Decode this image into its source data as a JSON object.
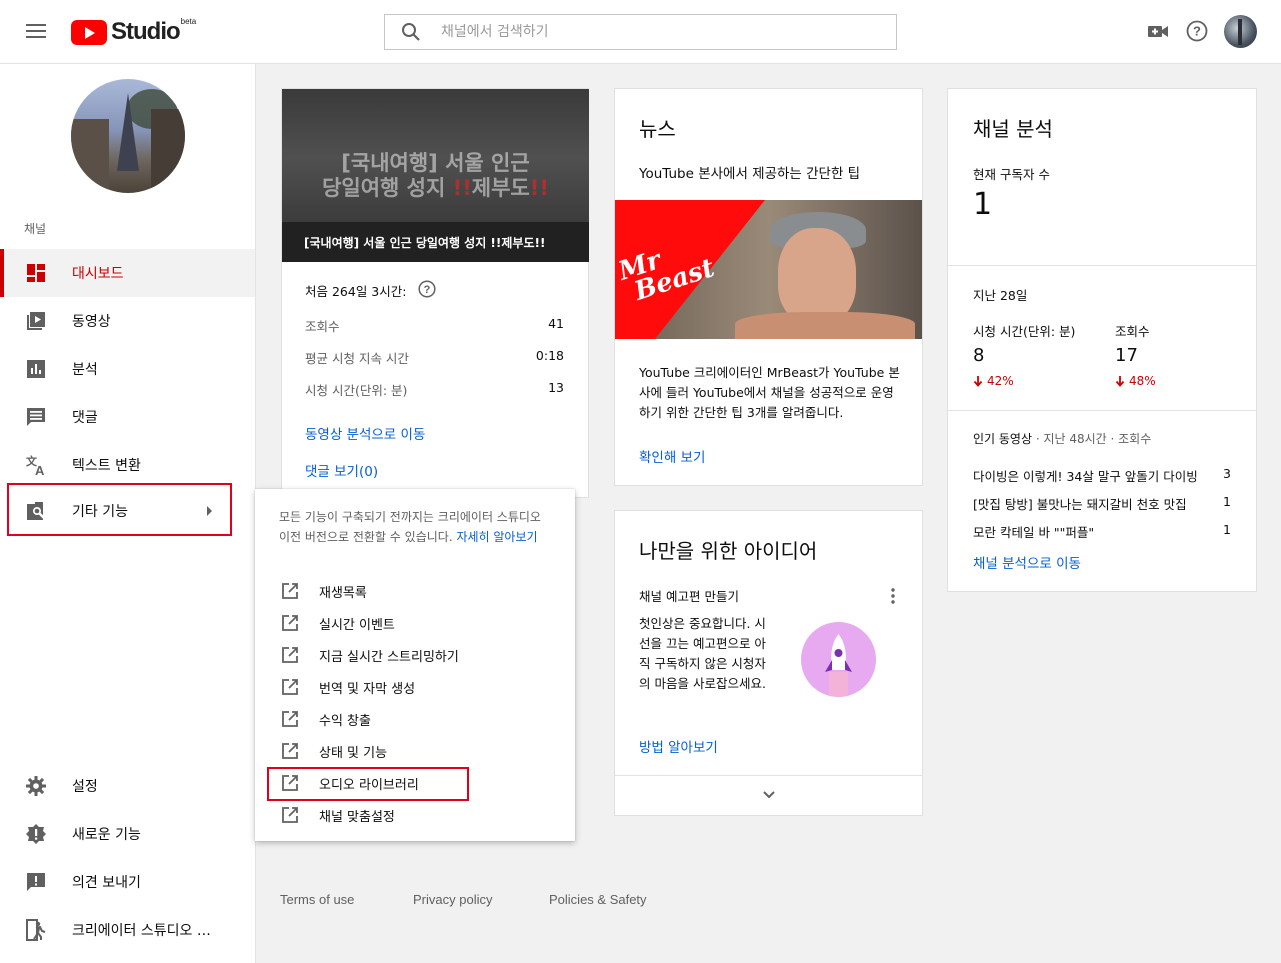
{
  "header": {
    "logo_text": "Studio",
    "logo_badge": "beta",
    "search_placeholder": "채널에서 검색하기"
  },
  "sidebar": {
    "section_label": "채널",
    "items": [
      {
        "label": "대시보드",
        "icon": "dashboard-icon"
      },
      {
        "label": "동영상",
        "icon": "video-library-icon"
      },
      {
        "label": "분석",
        "icon": "analytics-icon"
      },
      {
        "label": "댓글",
        "icon": "comments-icon"
      },
      {
        "label": "텍스트 변환",
        "icon": "translate-icon"
      },
      {
        "label": "기타 기능",
        "icon": "other-features-icon"
      }
    ],
    "bottom_items": [
      {
        "label": "설정",
        "icon": "gear-icon"
      },
      {
        "label": "새로운 기능",
        "icon": "whats-new-icon"
      },
      {
        "label": "의견 보내기",
        "icon": "feedback-icon"
      },
      {
        "label": "크리에이터 스튜디오 …",
        "icon": "classic-studio-icon"
      }
    ]
  },
  "latest_video": {
    "thumb_line1": "[국내여행] 서울 인근",
    "thumb_line2a": "당일여행 성지 ",
    "thumb_line2_mark1": "!!",
    "thumb_line2b": "제부도",
    "thumb_line2_mark2": "!!",
    "title": "[국내여행] 서울 인근 당일여행 성지 !!제부도!!",
    "first_period": "처음 264일 3시간:",
    "stats": [
      {
        "label": "조회수",
        "value": "41"
      },
      {
        "label": "평균 시청 지속 시간",
        "value": "0:18"
      },
      {
        "label": "시청 시간(단위: 분)",
        "value": "13"
      }
    ],
    "analytics_link": "동영상 분석으로 이동",
    "comments_link": "댓글 보기(0)"
  },
  "news": {
    "title": "뉴스",
    "subtitle": "YouTube 본사에서 제공하는 간단한 팁",
    "thumb_text_1": "Mr",
    "thumb_text_2": "Beast",
    "body": "YouTube 크리에이터인 MrBeast가 YouTube 본사에 들러 YouTube에서 채널을 성공적으로 운영하기 위한 간단한 팁 3개를 알려줍니다.",
    "link": "확인해 보기"
  },
  "ideas": {
    "title": "나만을 위한 아이디어",
    "item_title": "채널 예고편 만들기",
    "body": "첫인상은 중요합니다. 시선을 끄는 예고편으로 아직 구독하지 않은 시청자의 마음을 사로잡으세요.",
    "link": "방법 알아보기"
  },
  "channel_analytics": {
    "title": "채널 분석",
    "subscribers_label": "현재 구독자 수",
    "subscribers_value": "1",
    "period": "지난 28일",
    "watch_time_label": "시청 시간(단위: 분)",
    "watch_time_value": "8",
    "watch_time_change": "42%",
    "views_label": "조회수",
    "views_value": "17",
    "views_change": "48%",
    "top_videos_label": "인기 동영상",
    "top_videos_meta": " · 지난 48시간 · 조회수",
    "top_videos": [
      {
        "title": "다이빙은 이렇게! 34살 말구 앞돌기 다이빙",
        "views": "3"
      },
      {
        "title": "[맛집 탕방] 불맛나는 돼지갈비 천호 맛집",
        "views": "1"
      },
      {
        "title": "모란 칵테일 바 \"\"퍼플\"",
        "views": "1"
      }
    ],
    "link": "채널 분석으로 이동"
  },
  "popup": {
    "desc": "모든 기능이 구축되기 전까지는 크리에이터 스튜디오 이전 버전으로 전환할 수 있습니다. ",
    "desc_link": "자세히 알아보기",
    "items": [
      "재생목록",
      "실시간 이벤트",
      "지금 실시간 스트리밍하기",
      "번역 및 자막 생성",
      "수익 창출",
      "상태 및 기능",
      "오디오 라이브러리",
      "채널 맞춤설정"
    ]
  },
  "footer": {
    "links": [
      "Terms of use",
      "Privacy policy",
      "Policies & Safety"
    ]
  },
  "colors": {
    "accent_red": "#cc0000",
    "link_blue": "#065fd4",
    "highlight_outline": "#e0001b",
    "decrease_red": "#cc0000"
  }
}
